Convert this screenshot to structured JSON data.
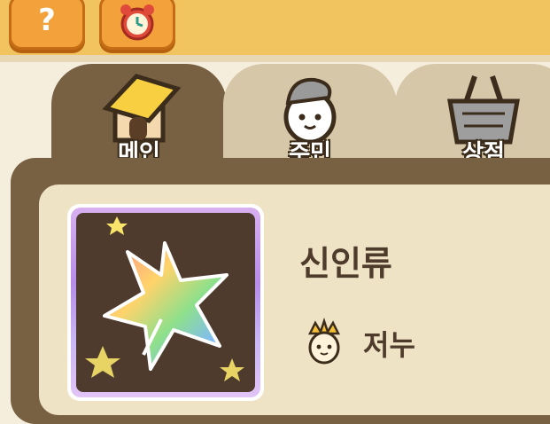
{
  "top_bar": {
    "help_button": {
      "icon": "question-mark-icon",
      "glyph": "?"
    },
    "clock_button": {
      "icon": "alarm-clock-icon"
    },
    "colors": {
      "bar": "#f2c460",
      "button": "#f3a13a"
    }
  },
  "tabs": [
    {
      "label": "메인",
      "icon": "house-icon",
      "active": true
    },
    {
      "label": "주민",
      "icon": "resident-icon",
      "active": false
    },
    {
      "label": "상점",
      "icon": "basket-icon",
      "active": false
    }
  ],
  "island": {
    "name": "신인류",
    "emblem": "rainbow-leaf-icon",
    "owner": {
      "icon": "crowned-resident-icon",
      "name": "저누"
    }
  }
}
